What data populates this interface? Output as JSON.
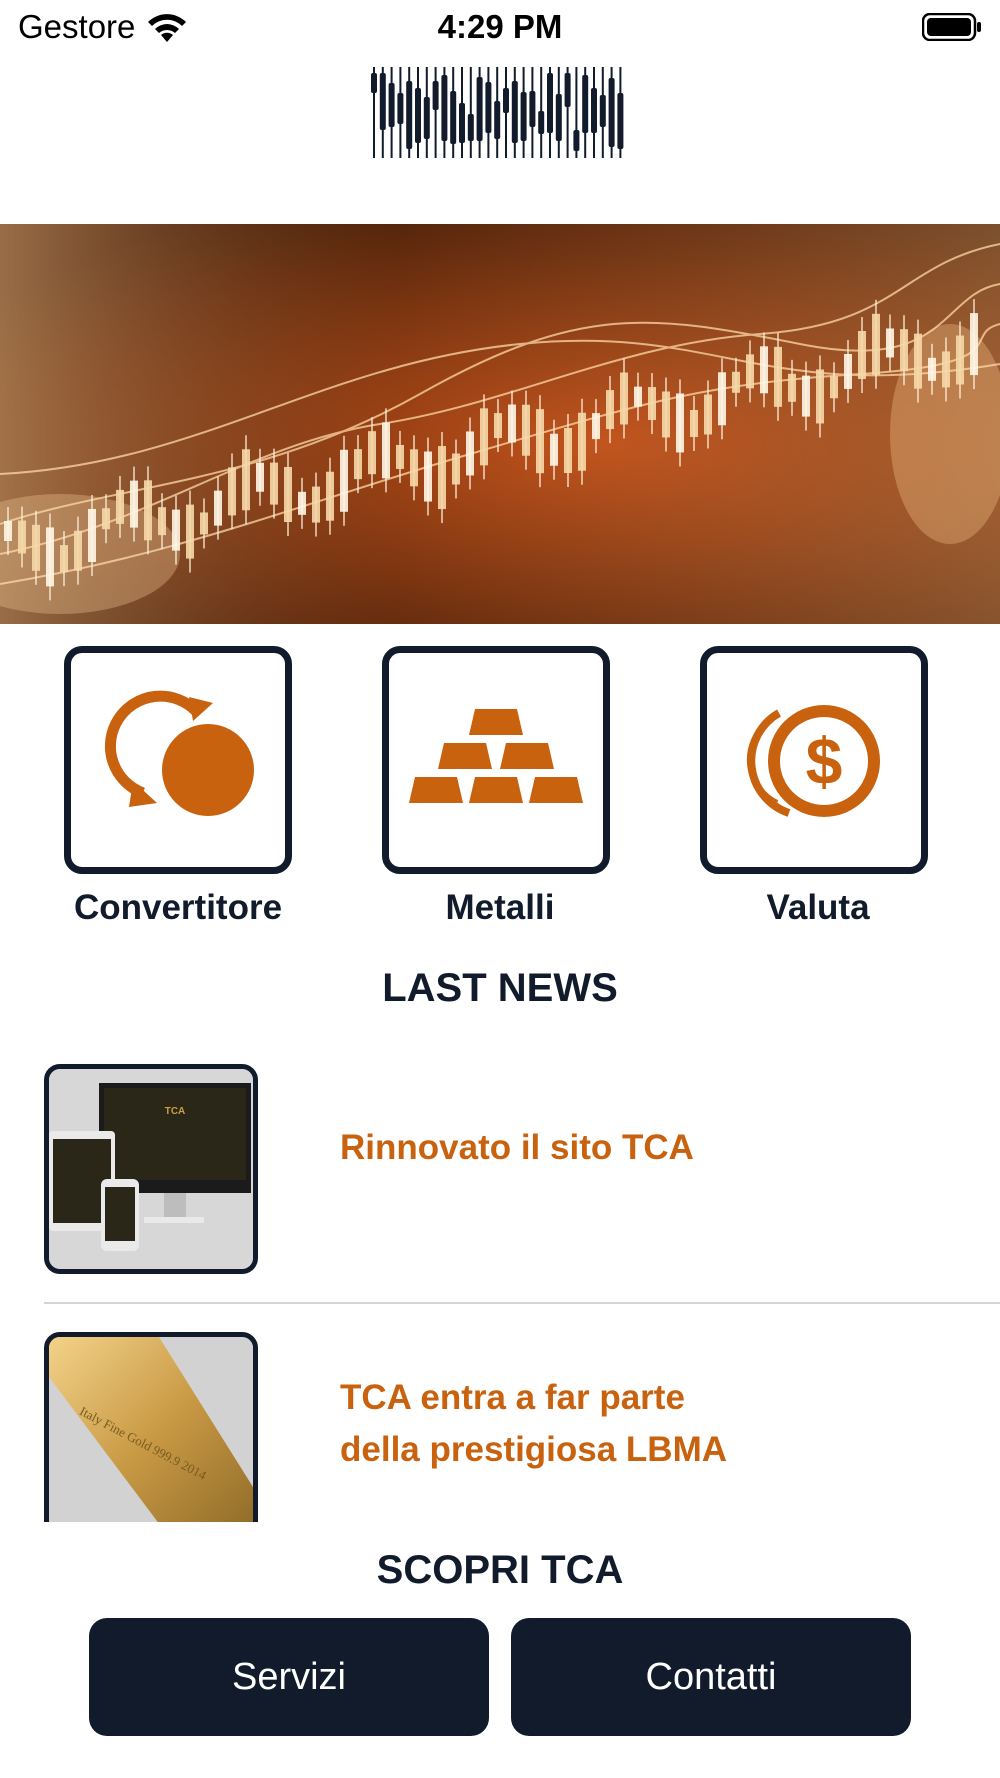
{
  "status_bar": {
    "carrier": "Gestore",
    "time": "4:29 PM"
  },
  "shortcuts": [
    {
      "label": "Convertitore",
      "icon": "converter-icon"
    },
    {
      "label": "Metalli",
      "icon": "gold-bars-icon"
    },
    {
      "label": "Valuta",
      "icon": "dollar-coin-icon"
    }
  ],
  "news": {
    "title": "LAST NEWS",
    "items": [
      {
        "title": "Rinnovato il sito TCA",
        "thumb_text": "TCA"
      },
      {
        "title": "TCA entra a far parte della prestigiosa LBMA",
        "thumb_text": "Italy Fine Gold 999.9 2014"
      }
    ]
  },
  "discover": {
    "title": "SCOPRI TCA",
    "services_label": "Servizi",
    "contacts_label": "Contatti"
  },
  "colors": {
    "accent": "#c8620f",
    "navy": "#111b2b"
  }
}
